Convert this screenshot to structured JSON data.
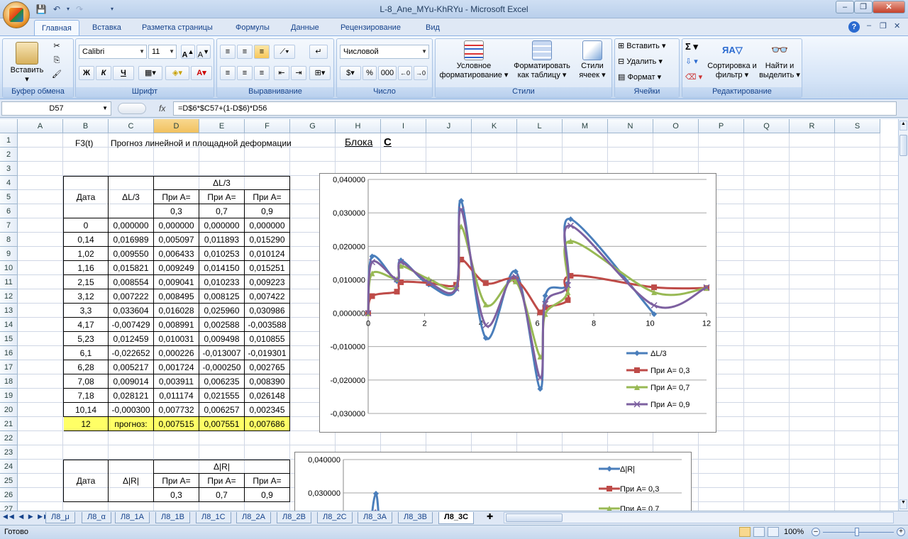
{
  "window": {
    "title": "L-8_Ane_MYu-KhRYu - Microsoft Excel"
  },
  "tabs": [
    "Главная",
    "Вставка",
    "Разметка страницы",
    "Формулы",
    "Данные",
    "Рецензирование",
    "Вид"
  ],
  "ribbon": {
    "clipboard": {
      "label": "Буфер обмена",
      "paste": "Вставить"
    },
    "font": {
      "label": "Шрифт",
      "name": "Calibri",
      "size": "11",
      "bold": "Ж",
      "italic": "К",
      "underline": "Ч"
    },
    "alignment": {
      "label": "Выравнивание"
    },
    "number": {
      "label": "Число",
      "format": "Числовой",
      "percent": "%",
      "thousands": "000"
    },
    "styles": {
      "label": "Стили",
      "cond": "Условное форматирование",
      "table": "Форматировать как таблицу",
      "cell": "Стили ячеек"
    },
    "cells": {
      "label": "Ячейки",
      "insert": "Вставить",
      "delete": "Удалить",
      "format": "Формат"
    },
    "editing": {
      "label": "Редактирование",
      "sort": "Сортировка и фильтр",
      "find": "Найти и выделить",
      "sigma": "Σ"
    }
  },
  "formula_bar": {
    "name_box": "D57",
    "fx": "fx",
    "formula": "=D$6*$C57+(1-D$6)*D56"
  },
  "columns": [
    "A",
    "B",
    "C",
    "D",
    "E",
    "F",
    "G",
    "H",
    "I",
    "J",
    "K",
    "L",
    "M",
    "N",
    "O",
    "P",
    "Q",
    "R",
    "S"
  ],
  "rows": [
    "1",
    "2",
    "3",
    "4",
    "5",
    "6",
    "7",
    "8",
    "9",
    "10",
    "11",
    "12",
    "13",
    "14",
    "15",
    "16",
    "17",
    "18",
    "19",
    "20",
    "21",
    "22",
    "23",
    "24",
    "25",
    "26",
    "27"
  ],
  "sheet": {
    "b1": "F3(t)",
    "c1": "Прогноз линейной и площадной  деформации",
    "h1": "Блока",
    "i1": "С",
    "table1": {
      "group_header": "ΔL/3",
      "date_header": "Дата",
      "delta_header": "ΔL/3",
      "pri_a": "При А=",
      "a_values": [
        "0,3",
        "0,7",
        "0,9"
      ],
      "rows": [
        [
          "0",
          "0,000000",
          "0,000000",
          "0,000000",
          "0,000000"
        ],
        [
          "0,14",
          "0,016989",
          "0,005097",
          "0,011893",
          "0,015290"
        ],
        [
          "1,02",
          "0,009550",
          "0,006433",
          "0,010253",
          "0,010124"
        ],
        [
          "1,16",
          "0,015821",
          "0,009249",
          "0,014150",
          "0,015251"
        ],
        [
          "2,15",
          "0,008554",
          "0,009041",
          "0,010233",
          "0,009223"
        ],
        [
          "3,12",
          "0,007222",
          "0,008495",
          "0,008125",
          "0,007422"
        ],
        [
          "3,3",
          "0,033604",
          "0,016028",
          "0,025960",
          "0,030986"
        ],
        [
          "4,17",
          "-0,007429",
          "0,008991",
          "0,002588",
          "-0,003588"
        ],
        [
          "5,23",
          "0,012459",
          "0,010031",
          "0,009498",
          "0,010855"
        ],
        [
          "6,1",
          "-0,022652",
          "0,000226",
          "-0,013007",
          "-0,019301"
        ],
        [
          "6,28",
          "0,005217",
          "0,001724",
          "-0,000250",
          "0,002765"
        ],
        [
          "7,08",
          "0,009014",
          "0,003911",
          "0,006235",
          "0,008390"
        ],
        [
          "7,18",
          "0,028121",
          "0,011174",
          "0,021555",
          "0,026148"
        ],
        [
          "10,14",
          "-0,000300",
          "0,007732",
          "0,006257",
          "0,002345"
        ]
      ],
      "forecast": [
        "12",
        "прогноз:",
        "0,007515",
        "0,007551",
        "0,007686"
      ]
    },
    "table2": {
      "group_header": "Δ|R|",
      "date_header": "Дата",
      "delta_header": "Δ|R|",
      "pri_a": "При А=",
      "a_values": [
        "0,3",
        "0,7",
        "0,9"
      ]
    }
  },
  "chart_data": [
    {
      "type": "scatter",
      "x": [
        0,
        0.14,
        1.02,
        1.16,
        2.15,
        3.12,
        3.3,
        4.17,
        5.23,
        6.1,
        6.28,
        7.08,
        7.18,
        10.14,
        12
      ],
      "series": [
        {
          "name": "ΔL/3",
          "color": "#4a7ebb",
          "marker": "diamond",
          "values": [
            0.0,
            0.016989,
            0.00955,
            0.015821,
            0.008554,
            0.007222,
            0.033604,
            -0.007429,
            0.012459,
            -0.022652,
            0.005217,
            0.009014,
            0.028121,
            -0.0003,
            null
          ]
        },
        {
          "name": "При А= 0,3",
          "color": "#be4b48",
          "marker": "square",
          "values": [
            0.0,
            0.005097,
            0.006433,
            0.009249,
            0.009041,
            0.008495,
            0.016028,
            0.008991,
            0.010031,
            0.000226,
            0.001724,
            0.003911,
            0.011174,
            0.007732,
            0.007515
          ]
        },
        {
          "name": "При А= 0,7",
          "color": "#98b954",
          "marker": "triangle",
          "values": [
            0.0,
            0.011893,
            0.010253,
            0.01415,
            0.010233,
            0.008125,
            0.02596,
            0.002588,
            0.009498,
            -0.013007,
            -0.00025,
            0.006235,
            0.021555,
            0.006257,
            0.007551
          ]
        },
        {
          "name": "При А= 0,9",
          "color": "#7d60a0",
          "marker": "x",
          "values": [
            0.0,
            0.01529,
            0.010124,
            0.015251,
            0.009223,
            0.007422,
            0.030986,
            -0.003588,
            0.010855,
            -0.019301,
            0.002765,
            0.00839,
            0.026148,
            0.002345,
            0.007686
          ]
        }
      ],
      "y_ticks": [
        "0,040000",
        "0,030000",
        "0,020000",
        "0,010000",
        "0,000000",
        "-0,010000",
        "-0,020000",
        "-0,030000"
      ],
      "x_ticks": [
        "0",
        "2",
        "4",
        "6",
        "8",
        "10",
        "12"
      ],
      "xlim": [
        0,
        12
      ],
      "ylim": [
        -0.03,
        0.04
      ],
      "grid": true,
      "legend": "right"
    },
    {
      "type": "scatter",
      "series": [
        {
          "name": "Δ|R|",
          "color": "#4a7ebb"
        },
        {
          "name": "При А= 0,3",
          "color": "#be4b48"
        },
        {
          "name": "При А= 0,7",
          "color": "#98b954"
        }
      ],
      "y_ticks": [
        "0,040000",
        "0,030000"
      ],
      "ylim": [
        0.0,
        0.04
      ],
      "grid": true,
      "legend": "right"
    }
  ],
  "sheet_tabs": [
    "Л8_μ",
    "Л8_α",
    "Л8_1А",
    "Л8_1В",
    "Л8_1С",
    "Л8_2А",
    "Л8_2В",
    "Л8_2С",
    "Л8_3А",
    "Л8_3В",
    "Л8_3С"
  ],
  "active_sheet": "Л8_3С",
  "status": {
    "ready": "Готово",
    "zoom": "100%"
  }
}
